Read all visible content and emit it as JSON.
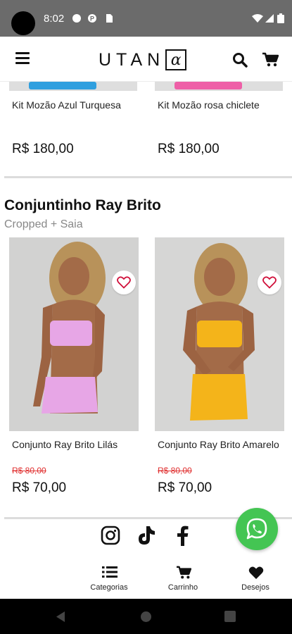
{
  "status_bar": {
    "time": "8:02"
  },
  "header": {
    "logo_text": "UTAN",
    "logo_mark": "α"
  },
  "top_products": [
    {
      "name": "Kit Mozão Azul Turquesa",
      "price": "R$  180,00",
      "color": "#2f9fdf"
    },
    {
      "name": "Kit Mozão rosa chiclete",
      "price": "R$  180,00",
      "color": "#ee5fa7"
    }
  ],
  "section": {
    "title": "Conjuntinho Ray Brito",
    "subtitle": "Cropped + Saia",
    "products": [
      {
        "name": "Conjunto Ray Brito Lilás",
        "old_price": "R$  80,00",
        "price": "R$  70,00",
        "color": "#e7a6e6"
      },
      {
        "name": "Conjunto Ray Brito Amarelo",
        "old_price": "R$  80,00",
        "price": "R$  70,00",
        "color": "#f4b41a"
      }
    ]
  },
  "social": [
    "instagram-icon",
    "tiktok-icon",
    "facebook-icon"
  ],
  "tabs": [
    {
      "label": "Categorias",
      "icon": "list-icon"
    },
    {
      "label": "Carrinho",
      "icon": "cart-icon"
    },
    {
      "label": "Desejos",
      "icon": "heart-icon"
    }
  ],
  "colors": {
    "accent_green": "#44c553",
    "old_price_red": "#e03030",
    "status_bar": "#6b6b6b"
  }
}
